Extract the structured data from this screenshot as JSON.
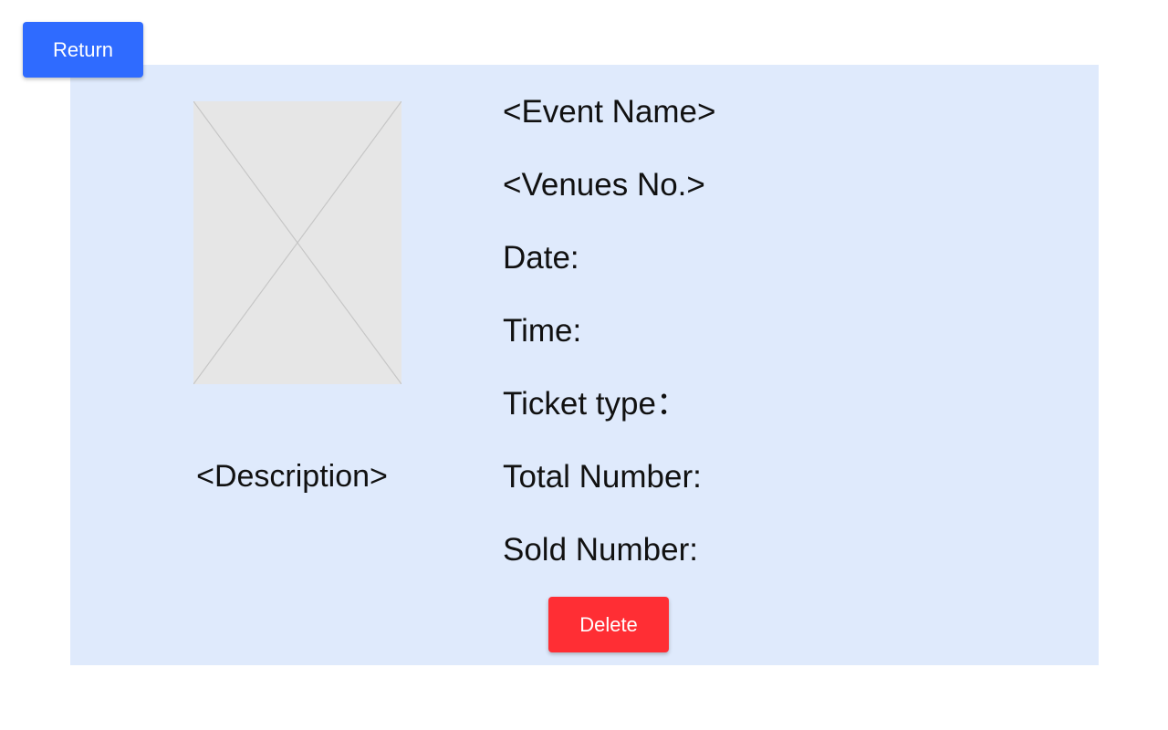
{
  "toolbar": {
    "return_label": "Return"
  },
  "event": {
    "image_icon": "image-placeholder-icon",
    "description": "<Description>",
    "name": "<Event Name>",
    "venues": "<Venues No.>",
    "date_label": "Date:",
    "time_label": "Time:",
    "ticket_type_label": "Ticket type：",
    "total_number_label": "Total Number:",
    "sold_number_label": "Sold Number:"
  },
  "actions": {
    "delete_label": "Delete"
  },
  "colors": {
    "panel_background": "#dfeafc",
    "return_button": "#2f6bff",
    "delete_button": "#ff2e34",
    "image_placeholder": "#e6e6e6"
  }
}
